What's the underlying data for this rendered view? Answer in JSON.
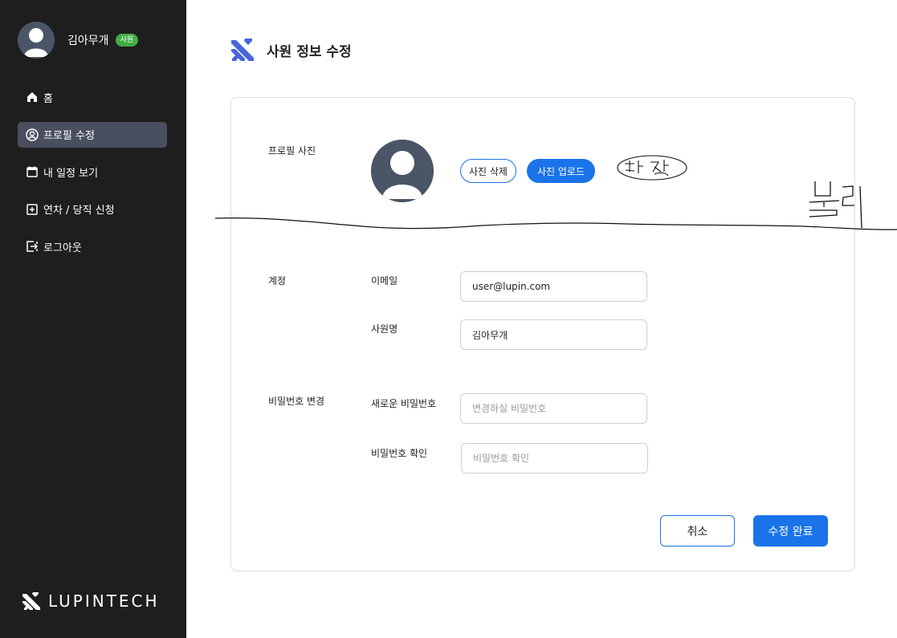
{
  "sidebar": {
    "user_name": "김아무개",
    "role_badge": "사원",
    "items": [
      {
        "label": "홈",
        "icon": "home-icon"
      },
      {
        "label": "프로필 수정",
        "icon": "user-circle-icon",
        "active": true
      },
      {
        "label": "내 일정 보기",
        "icon": "calendar-icon"
      },
      {
        "label": "연차 / 당직 신청",
        "icon": "plus-square-icon"
      },
      {
        "label": "로그아웃",
        "icon": "logout-icon"
      }
    ],
    "brand": "LUPINTECH"
  },
  "header": {
    "title": "사원 정보 수정"
  },
  "form": {
    "photo_section_label": "프로필 사진",
    "delete_photo_label": "사진 삭제",
    "upload_photo_label": "사진 업로드",
    "account_section_label": "계정",
    "email_label": "이메일",
    "email_value": "user@lupin.com",
    "name_label": "사원명",
    "name_value": "김아무개",
    "password_section_label": "비밀번호 변경",
    "new_password_label": "새로운 비밀번호",
    "new_password_placeholder": "변경하실 비밀번호",
    "confirm_password_label": "비밀번호 확인",
    "confirm_password_placeholder": "비밀번호 확인",
    "cancel_label": "취소",
    "submit_label": "수정 완료"
  },
  "colors": {
    "sidebar_bg": "#1e1e1e",
    "active_item_bg": "#4a4f60",
    "accent": "#1a73e8",
    "badge": "#3fae45",
    "avatar": "#4a5568"
  }
}
